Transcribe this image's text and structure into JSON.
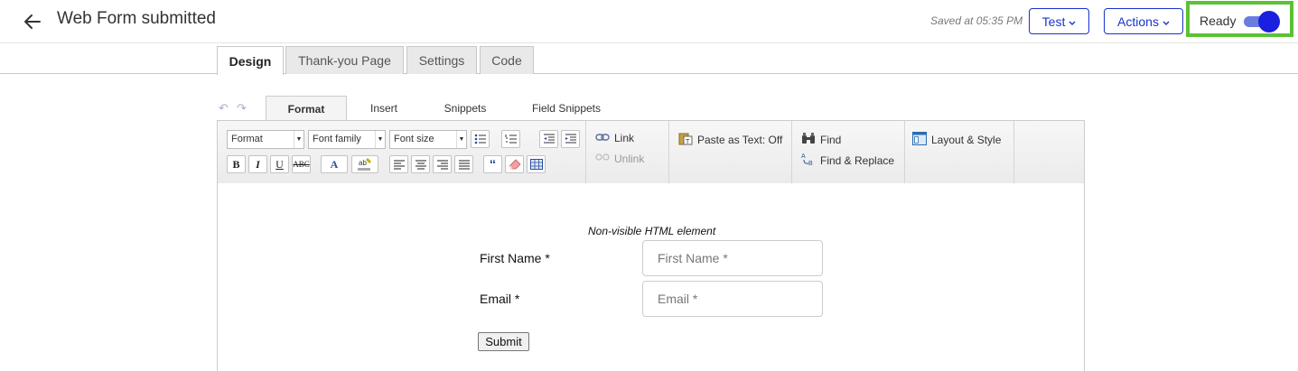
{
  "header": {
    "title": "Web Form submitted",
    "saved_text": "Saved at 05:35 PM",
    "test_label": "Test",
    "actions_label": "Actions",
    "ready_label": "Ready",
    "ready_toggle_on": true
  },
  "page_tabs": [
    {
      "label": "Design",
      "active": true
    },
    {
      "label": "Thank-you Page",
      "active": false
    },
    {
      "label": "Settings",
      "active": false
    },
    {
      "label": "Code",
      "active": false
    }
  ],
  "editor_tabs": [
    {
      "label": "Format",
      "active": true
    },
    {
      "label": "Insert",
      "active": false
    },
    {
      "label": "Snippets",
      "active": false
    },
    {
      "label": "Field Snippets",
      "active": false
    }
  ],
  "toolbar": {
    "format_select": "Format",
    "font_family_select": "Font family",
    "font_size_select": "Font size",
    "link_label": "Link",
    "unlink_label": "Unlink",
    "paste_text_label": "Paste as Text: Off",
    "find_label": "Find",
    "find_replace_label": "Find & Replace",
    "layout_style_label": "Layout & Style"
  },
  "content": {
    "nonvisible_note": "Non-visible HTML element",
    "first_name_label": "First Name *",
    "first_name_placeholder": "First Name *",
    "email_label": "Email *",
    "email_placeholder": "Email *",
    "submit_label": "Submit"
  },
  "colors": {
    "accent": "#1a33c9",
    "highlight_border": "#5bc236",
    "toggle_knob": "#1a1fe0"
  }
}
